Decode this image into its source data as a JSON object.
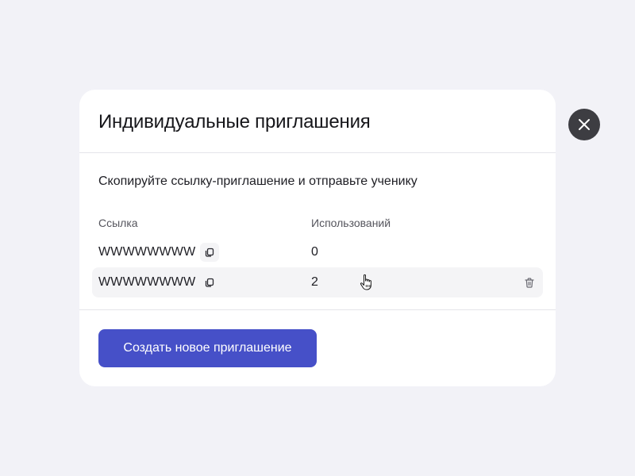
{
  "modal": {
    "title": "Индивидуальные приглашения",
    "instruction": "Скопируйте ссылку-приглашение и отправьте ученику",
    "table": {
      "columns": [
        "Ссылка",
        "Использований"
      ],
      "rows": [
        {
          "link": "WWWWWWWW",
          "uses": "0"
        },
        {
          "link": "WWWWWWWW",
          "uses": "2"
        }
      ]
    },
    "create_button_label": "Создать новое приглашение"
  },
  "icons": {
    "copy": "copy-icon",
    "delete": "trash-icon",
    "close": "close-icon",
    "cursor": "hand-pointer-icon"
  },
  "colors": {
    "background": "#f2f2f7",
    "primary": "#4650c8",
    "close_button": "#3d3d42",
    "row_highlight": "#f4f4f6"
  }
}
